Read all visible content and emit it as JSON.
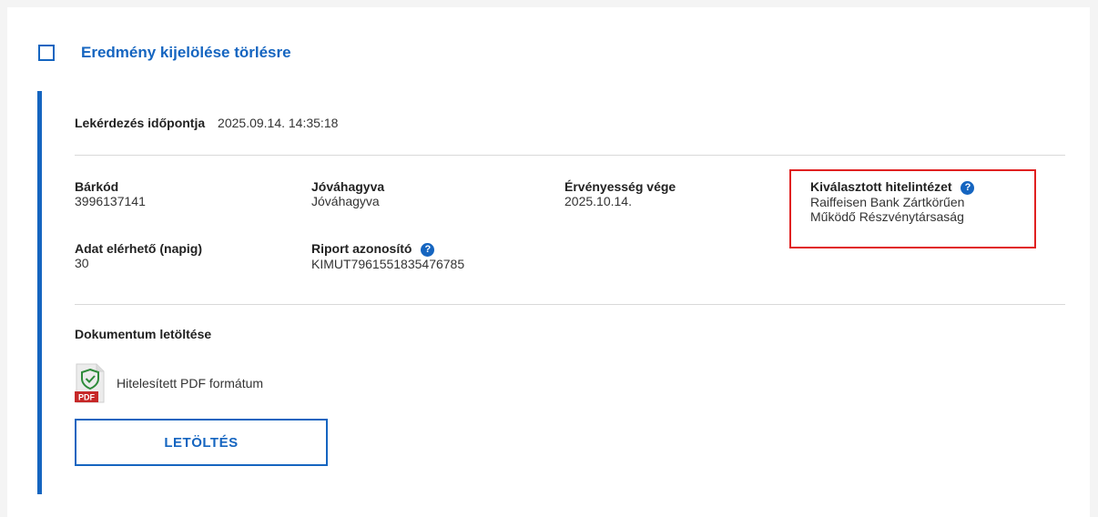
{
  "header": {
    "select_label": "Eredmény kijelölése törlésre"
  },
  "query": {
    "label": "Lekérdezés időpontja",
    "value": "2025.09.14. 14:35:18"
  },
  "fields": {
    "barcode": {
      "label": "Bárkód",
      "value": "3996137141"
    },
    "approved": {
      "label": "Jóváhagyva",
      "value": "Jóváhagyva"
    },
    "validity": {
      "label": "Érvényesség vége",
      "value": "2025.10.14."
    },
    "institution": {
      "label": "Kiválasztott hitelintézet",
      "value_line1": "Raiffeisen Bank Zártkörűen",
      "value_line2": "Működő Részvénytársaság"
    },
    "availability": {
      "label": "Adat elérhető (napig)",
      "value": "30"
    },
    "report_id": {
      "label": "Riport azonosító",
      "value": "KIMUT7961551835476785"
    }
  },
  "document": {
    "title": "Dokumentum letöltése",
    "pdf_label": "Hitelesített PDF formátum",
    "pdf_badge": "PDF"
  },
  "actions": {
    "download_label": "LETÖLTÉS"
  },
  "colors": {
    "accent": "#1565c0",
    "highlight": "#e02020",
    "pdf_red": "#c62828",
    "shield_green": "#2e8b3a"
  }
}
